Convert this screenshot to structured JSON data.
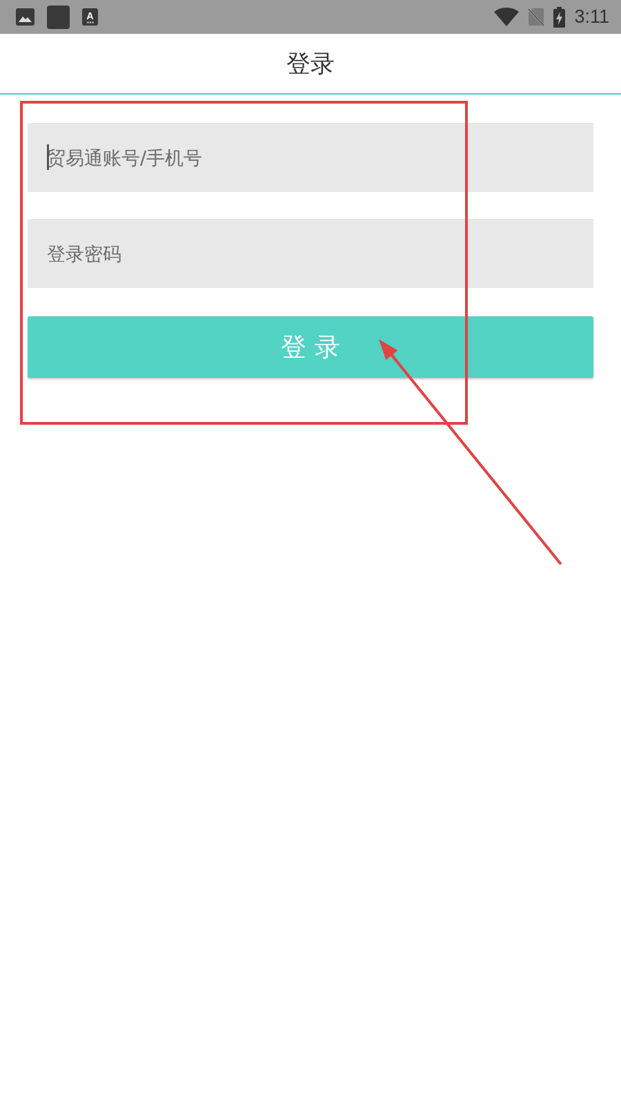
{
  "status_bar": {
    "notification_icons": [
      {
        "kind": "image"
      },
      {
        "kind": "app"
      },
      {
        "kind": "glyph",
        "glyph": "A"
      }
    ],
    "time": "3:11"
  },
  "header": {
    "title": "登录"
  },
  "form": {
    "fields": [
      {
        "placeholder": "贸易通账号/手机号",
        "focused": true
      },
      {
        "placeholder": "登录密码",
        "focused": false
      }
    ],
    "submit": "登 录"
  },
  "annotations": [
    {
      "kind": "rectangle"
    },
    {
      "kind": "arrow"
    }
  ]
}
